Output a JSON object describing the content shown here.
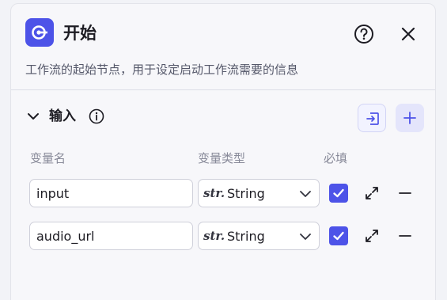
{
  "node": {
    "title": "开始",
    "description": "工作流的起始节点，用于设定启动工作流需要的信息",
    "icon": "start-node-icon",
    "accent_color": "#4d53e8"
  },
  "header": {
    "help_icon": "help-circle-icon",
    "close_icon": "close-icon"
  },
  "input_section": {
    "title": "输入",
    "expanded": true,
    "columns": {
      "name": "变量名",
      "type": "变量类型",
      "required": "必填"
    },
    "rows": [
      {
        "name": "input",
        "type_prefix": "str.",
        "type": "String",
        "required": true
      },
      {
        "name": "audio_url",
        "type_prefix": "str.",
        "type": "String",
        "required": true
      }
    ]
  }
}
